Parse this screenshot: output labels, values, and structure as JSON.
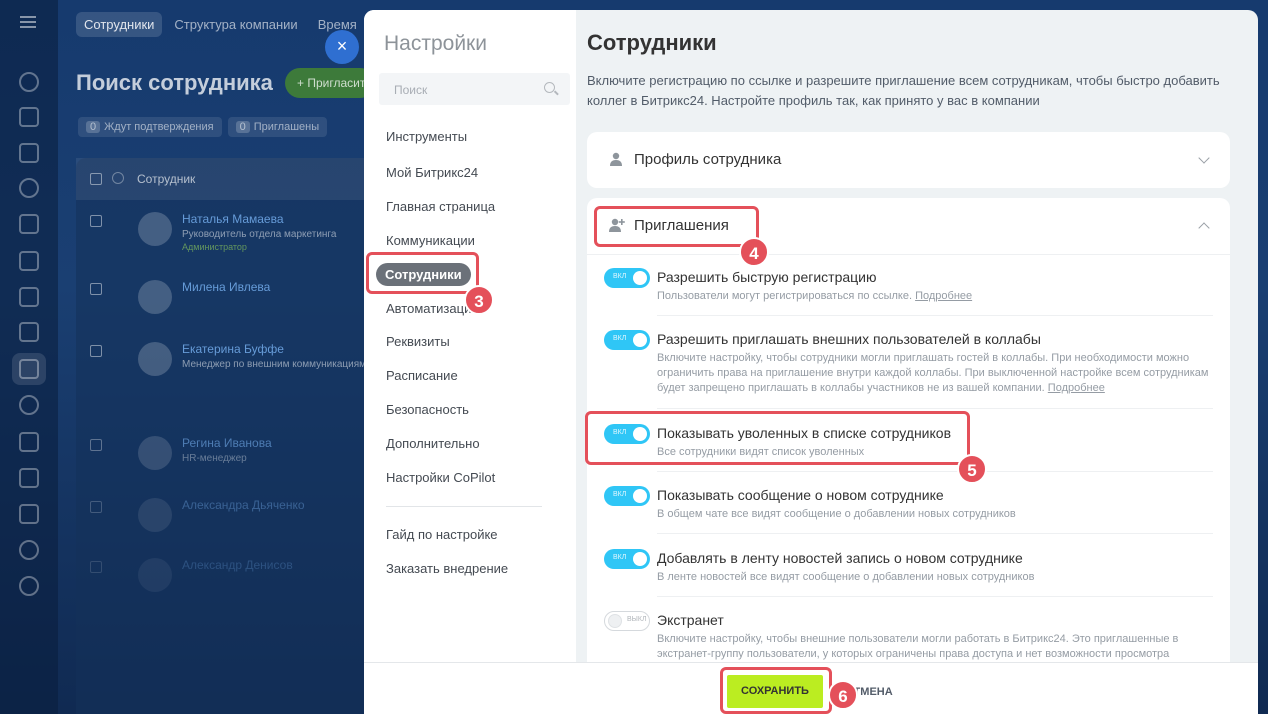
{
  "background": {
    "tabs": [
      "Сотрудники",
      "Структура компании",
      "Время"
    ],
    "page_title": "Поиск сотрудника",
    "invite_button": "+ Пригласить",
    "counters": [
      {
        "count": "0",
        "label": "Ждут подтверждения"
      },
      {
        "count": "0",
        "label": "Приглашены"
      }
    ],
    "table_header": "Сотрудник",
    "employees": [
      {
        "name": "Наталья Мамаева",
        "position": "Руководитель отдела маркетинга",
        "role": "Администратор"
      },
      {
        "name": "Милена Ивлева",
        "position": "",
        "role": ""
      },
      {
        "name": "Екатерина Буффе",
        "position": "Менеджер по внешним коммуникациям",
        "role": ""
      },
      {
        "name": "Регина Иванова",
        "position": "HR-менеджер",
        "role": ""
      },
      {
        "name": "Александра Дьяченко",
        "position": "",
        "role": ""
      },
      {
        "name": "Александр Денисов",
        "position": "",
        "role": ""
      }
    ],
    "close_symbol": "×"
  },
  "sidebar": {
    "title": "Настройки",
    "search_placeholder": "Поиск",
    "items": [
      "Инструменты",
      "Мой Битрикс24",
      "Главная страница",
      "Коммуникации",
      "Сотрудники",
      "Автоматизация",
      "Реквизиты",
      "Расписание",
      "Безопасность",
      "Дополнительно",
      "Настройки CoPilot"
    ],
    "active_item": "Сотрудники",
    "extra_items": [
      "Гайд по настройке",
      "Заказать внедрение"
    ]
  },
  "content": {
    "title": "Сотрудники",
    "description": "Включите регистрацию по ссылке и разрешите приглашение всем сотрудникам, чтобы быстро добавить коллег в Битрикс24. Настройте профиль так, как принято у вас в компании",
    "profile_section": "Профиль сотрудника",
    "invites_section": "Приглашения",
    "toggle_on_label": "ВКЛ",
    "toggle_off_label": "ВЫКЛ",
    "more_link": "Подробнее",
    "options": [
      {
        "title": "Разрешить быструю регистрацию",
        "desc": "Пользователи могут регистрироваться по ссылке.",
        "enabled": true
      },
      {
        "title": "Разрешить приглашать внешних пользователей в коллабы",
        "desc": "Включите настройку, чтобы сотрудники могли приглашать гостей в коллабы. При необходимости можно ограничить права на приглашение внутри каждой коллабы. При выключенной настройке всем сотрудникам будет запрещено приглашать в коллабы участников не из вашей компании.",
        "enabled": true
      },
      {
        "title": "Показывать уволенных в списке сотрудников",
        "desc": "Все сотрудники видят список уволенных",
        "enabled": true
      },
      {
        "title": "Показывать сообщение о новом сотруднике",
        "desc": "В общем чате все видят сообщение о добавлении новых сотрудников",
        "enabled": true
      },
      {
        "title": "Добавлять в ленту новостей запись о новом сотруднике",
        "desc": "В ленте новостей все видят сообщение о добавлении новых сотрудников",
        "enabled": true
      },
      {
        "title": "Экстранет",
        "desc": "Включите настройку, чтобы внешние пользователи могли работать в Битрикс24. Это приглашенные в экстранет-группу пользователи, у которых ограничены права доступа и нет возможности просмотра",
        "enabled": false
      }
    ]
  },
  "footer": {
    "save_label": "СОХРАНИТЬ",
    "cancel_label": "ОТМЕНА"
  },
  "annotations": {
    "step3": "3",
    "step4": "4",
    "step5": "5",
    "step6": "6",
    "color": "#e4505a"
  }
}
